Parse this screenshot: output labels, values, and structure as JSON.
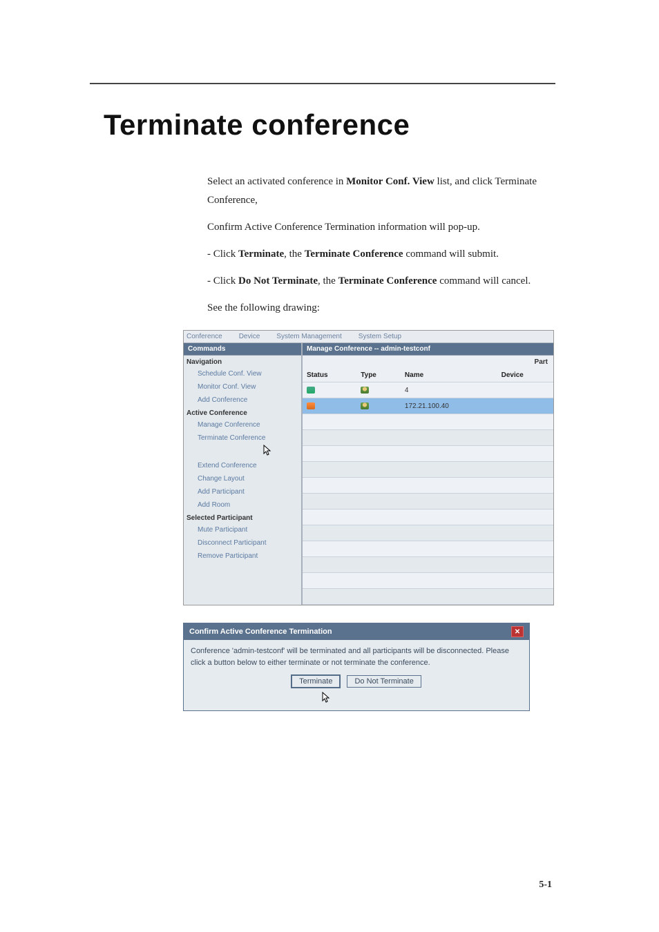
{
  "title": "Terminate conference",
  "para": {
    "intro1a": "Select an activated conference in ",
    "intro1b": "Monitor Conf. View",
    "intro1c": " list, and click Terminate Conference,",
    "intro2": " Confirm Active Conference Termination information will pop-up.",
    "b1a": "-   Click ",
    "b1b": "Terminate",
    "b1c": ", the ",
    "b1d": "Terminate Conference",
    "b1e": " command will submit.",
    "b2a": "-   Click ",
    "b2b": "Do Not Terminate",
    "b2c": ", the ",
    "b2d": "Terminate Conference",
    "b2e": " command will cancel.",
    "see": "See the following drawing:"
  },
  "menubar": {
    "items": [
      "Conference",
      "Device",
      "System Management",
      "System Setup"
    ]
  },
  "sidebar": {
    "header": "Commands",
    "navigation_label": "Navigation",
    "navigation": [
      "Schedule Conf. View",
      "Monitor Conf. View",
      "Add Conference"
    ],
    "active_label": "Active Conference",
    "active": [
      "Manage Conference",
      "Terminate Conference",
      "Extend Conference",
      "Change Layout",
      "Add Participant",
      "Add Room"
    ],
    "selected_label": "Selected Participant",
    "selected": [
      "Mute Participant",
      "Disconnect Participant",
      "Remove Participant"
    ]
  },
  "content": {
    "header": "Manage Conference -- admin-testconf",
    "part_label": "Part",
    "columns": [
      "Status",
      "Type",
      "Name",
      "Device"
    ],
    "rows": [
      {
        "status": "call",
        "type": "person",
        "name": "4",
        "device": "",
        "sel": false
      },
      {
        "status": "call2",
        "type": "person",
        "name": "172.21.100.40",
        "device": "",
        "sel": true
      }
    ]
  },
  "dialog": {
    "title": "Confirm Active Conference Termination",
    "body": "Conference 'admin-testconf' will be terminated and all participants will be disconnected.  Please click a button below to either terminate or not terminate the conference.",
    "btn_terminate": "Terminate",
    "btn_do_not": "Do Not Terminate"
  },
  "pagenum": "5-1"
}
